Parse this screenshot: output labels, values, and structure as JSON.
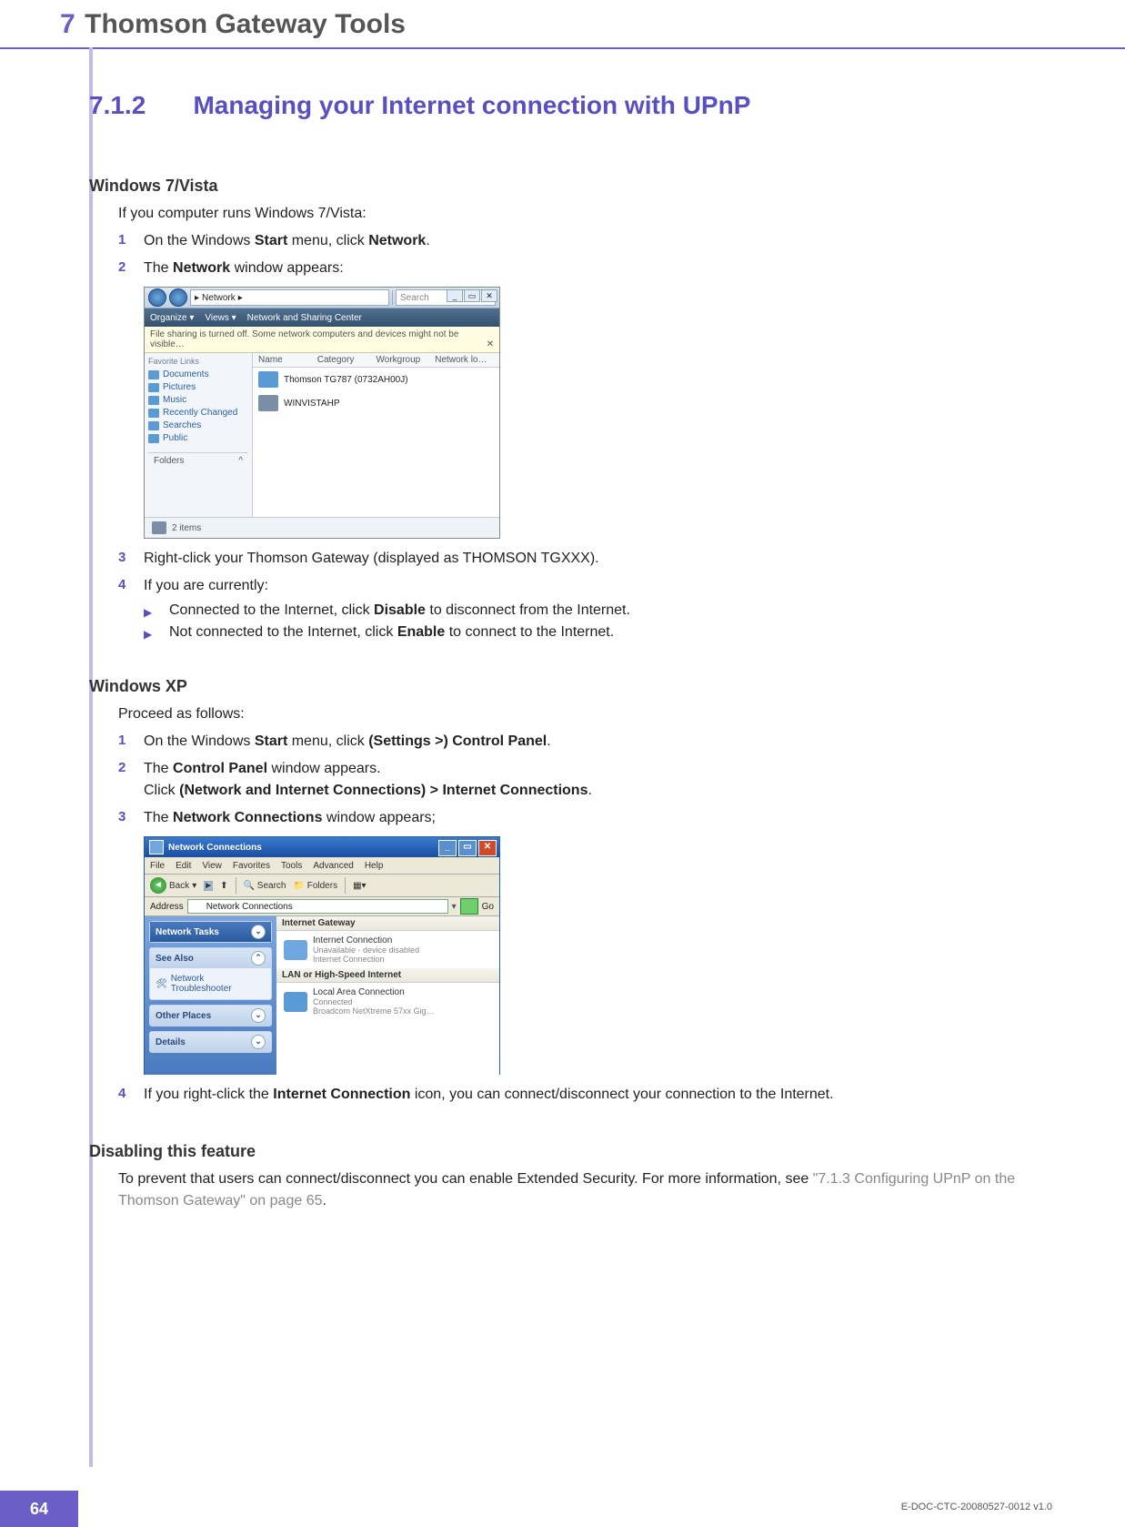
{
  "header": {
    "chapter_num": "7",
    "chapter_title": "Thomson Gateway Tools"
  },
  "section": {
    "num": "7.1.2",
    "title": "Managing your Internet connection with UPnP"
  },
  "win7": {
    "heading": "Windows 7/Vista",
    "intro": "If you computer runs Windows 7/Vista:",
    "items": [
      {
        "n": "1",
        "pre": "On the Windows ",
        "b1": "Start",
        "mid": " menu, click ",
        "b2": "Network",
        "post": "."
      },
      {
        "n": "2",
        "pre": "The ",
        "b1": "Network",
        "post": " window appears:"
      },
      {
        "n": "3",
        "text": "Right-click your Thomson Gateway (displayed as THOMSON TGXXX)."
      },
      {
        "n": "4",
        "text": "If you are currently:"
      }
    ],
    "subs": [
      {
        "pre": "Connected to the Internet, click ",
        "b": "Disable",
        "post": " to disconnect from the Internet."
      },
      {
        "pre": "Not connected to the Internet, click ",
        "b": "Enable",
        "post": " to connect to the Internet."
      }
    ],
    "shot": {
      "path_label": "Network",
      "path_arrow": "▸",
      "search_placeholder": "Search",
      "tb_organize": "Organize ▾",
      "tb_views": "Views ▾",
      "tb_nsc": "Network and Sharing Center",
      "infobar": "File sharing is turned off. Some network computers and devices might not be visible…",
      "fav": "Favorite Links",
      "links": [
        "Documents",
        "Pictures",
        "Music",
        "Recently Changed",
        "Searches",
        "Public"
      ],
      "folders": "Folders",
      "folders_chev": "^",
      "cols": {
        "c1": "Name",
        "c2": "Category",
        "c3": "Workgroup",
        "c4": "Network lo…"
      },
      "dev": "Thomson TG787 (0732AH00J)",
      "pc": "WINVISTAHP",
      "status": "2 items",
      "ctrl_min": "_",
      "ctrl_max": "▭",
      "ctrl_close": "✕"
    }
  },
  "xp": {
    "heading": "Windows XP",
    "intro": "Proceed as follows:",
    "items": [
      {
        "n": "1",
        "pre": "On the Windows ",
        "b1": "Start",
        "mid": " menu, click ",
        "b2": "(Settings >) Control Panel",
        "post": "."
      },
      {
        "n": "2",
        "pre": "The ",
        "b1": "Control Panel",
        "mid": " window appears.",
        "br": true,
        "pre2": "Click ",
        "b2": "(Network and Internet Connections) > Internet Connections",
        "post": "."
      },
      {
        "n": "3",
        "pre": "The ",
        "b1": "Network Connections",
        "post": " window appears;"
      },
      {
        "n": "4",
        "pre": "If you right-click the ",
        "b1": "Internet Connection",
        "post": " icon, you can connect/disconnect your connection to the Internet."
      }
    ],
    "shot": {
      "title": "Network Connections",
      "menu": [
        "File",
        "Edit",
        "View",
        "Favorites",
        "Tools",
        "Advanced",
        "Help"
      ],
      "back": "Back",
      "search": "Search",
      "folders": "Folders",
      "addr_label": "Address",
      "addr_value": "Network Connections",
      "go": "Go",
      "panels": {
        "tasks": "Network Tasks",
        "see": "See Also",
        "see_item": "Network Troubleshooter",
        "other": "Other Places",
        "details": "Details"
      },
      "grp1": "Internet Gateway",
      "ig": {
        "t1": "Internet Connection",
        "t2": "Unavailable - device disabled",
        "t3": "Internet Connection"
      },
      "grp2": "LAN or High-Speed Internet",
      "lan": {
        "t1": "Local Area Connection",
        "t2": "Connected",
        "t3": "Broadcom NetXtreme 57xx Gig…"
      },
      "ctrl_min": "_",
      "ctrl_max": "▭",
      "ctrl_close": "✕"
    }
  },
  "disable": {
    "heading": "Disabling this feature",
    "text_pre": "To prevent that users can connect/disconnect you can enable Extended Security. For more information, see ",
    "link": "\"7.1.3 Configuring UPnP on the Thomson Gateway\" on page 65",
    "text_post": "."
  },
  "footer": {
    "page": "64",
    "docid": "E-DOC-CTC-20080527-0012 v1.0"
  }
}
